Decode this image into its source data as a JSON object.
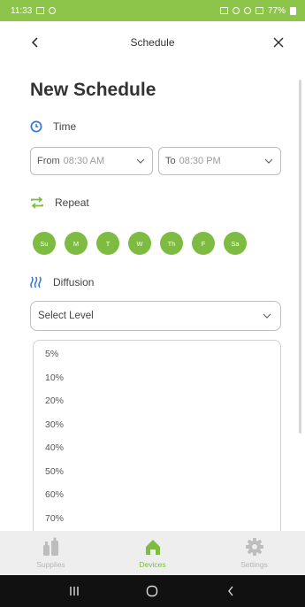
{
  "status_bar": {
    "time": "11:33",
    "battery": "77%"
  },
  "header": {
    "title": "Schedule"
  },
  "page": {
    "title": "New Schedule"
  },
  "time_section": {
    "label": "Time",
    "from_label": "From",
    "from_value": "08:30 AM",
    "to_label": "To",
    "to_value": "08:30 PM"
  },
  "repeat_section": {
    "label": "Repeat",
    "days": [
      "Su",
      "M",
      "T",
      "W",
      "Th",
      "F",
      "Sa"
    ]
  },
  "diffusion_section": {
    "label": "Diffusion",
    "select_placeholder": "Select Level",
    "options": [
      "5%",
      "10%",
      "20%",
      "30%",
      "40%",
      "50%",
      "60%",
      "70%"
    ]
  },
  "bottom_nav": {
    "tabs": [
      {
        "label": "Supplies",
        "icon": "bottles-icon"
      },
      {
        "label": "Devices",
        "icon": "home-icon",
        "active": true
      },
      {
        "label": "Settings",
        "icon": "gear-icon"
      }
    ]
  },
  "colors": {
    "accent_green": "#7dbb42",
    "status_green": "#8dc54b",
    "time_icon_blue": "#3a7bd5"
  }
}
